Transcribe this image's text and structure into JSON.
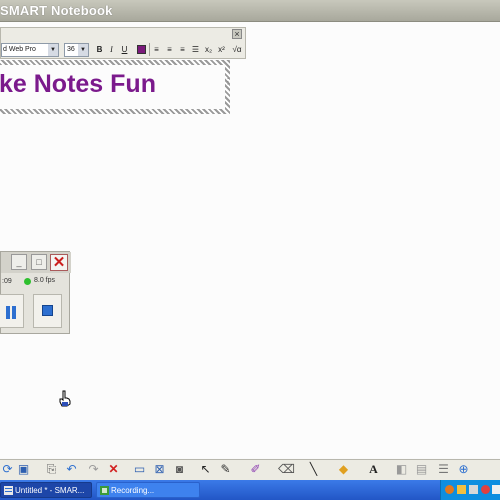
{
  "app": {
    "title": "SMART Notebook"
  },
  "format_toolbar": {
    "font_name": "d Web Pro",
    "font_size": "36",
    "bold": "B",
    "italic": "I",
    "underline": "U",
    "text_color": "#7b1a7b",
    "align_left": "≡",
    "align_center": "≡",
    "align_right": "≡",
    "bullets": "☰",
    "subscript": "x₂",
    "superscript": "x²",
    "math": "√α",
    "close": "×"
  },
  "canvas": {
    "heading": "ke Notes Fun",
    "heading_color": "#7b1a8c"
  },
  "recorder": {
    "elapsed": ":09",
    "fps": "8.0 fps",
    "minimize": "_",
    "maximize": "□",
    "close": "✕"
  },
  "bottom_toolbar": {
    "icons": [
      "refresh-icon",
      "save-icon",
      "paste-icon",
      "undo-icon",
      "redo-icon",
      "delete-icon",
      "screen-shade-icon",
      "fullscreen-icon",
      "camera-icon",
      "select-icon",
      "pen-icon",
      "creative-pen-icon",
      "eraser-icon",
      "line-icon",
      "shape-icon",
      "text-icon",
      "fill-icon",
      "properties-icon",
      "move-toolbar-icon",
      "help-icon"
    ]
  },
  "taskbar": {
    "tasks": [
      {
        "label": "Untitled * - SMAR...",
        "active": true
      },
      {
        "label": "Recording...",
        "active": false
      }
    ]
  }
}
